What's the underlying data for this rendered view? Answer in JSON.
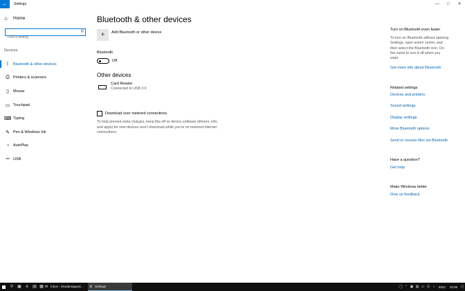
{
  "window": {
    "back_icon": "arrow-left-icon",
    "title": "Settings",
    "controls": [
      "—",
      "□",
      "✕"
    ]
  },
  "sidebar": {
    "home_label": "Home",
    "search_placeholder": "Find a setting",
    "group_label": "Devices",
    "items": [
      {
        "label": "Bluetooth & other devices",
        "icon": "bluetooth-icon",
        "glyph": "ᛒ",
        "active": true
      },
      {
        "label": "Printers & scanners",
        "icon": "printer-icon",
        "glyph": "⎙",
        "active": false
      },
      {
        "label": "Mouse",
        "icon": "mouse-icon",
        "glyph": "▯",
        "active": false
      },
      {
        "label": "Touchpad",
        "icon": "touchpad-icon",
        "glyph": "▭",
        "active": false
      },
      {
        "label": "Typing",
        "icon": "keyboard-icon",
        "glyph": "⌨",
        "active": false
      },
      {
        "label": "Pen & Windows Ink",
        "icon": "pen-icon",
        "glyph": "✎",
        "active": false
      },
      {
        "label": "AutoPlay",
        "icon": "autoplay-icon",
        "glyph": "◔",
        "active": false
      },
      {
        "label": "USB",
        "icon": "usb-icon",
        "glyph": "⎓",
        "active": false
      }
    ]
  },
  "main": {
    "title": "Bluetooth & other devices",
    "add_label": "Add Bluetooth or other device",
    "bluetooth_label": "Bluetooth",
    "bluetooth_state": "Off",
    "other_devices_title": "Other devices",
    "device_name": "Card Reader",
    "device_status": "Connected to USB 3.0",
    "metered_label": "Download over metered connections",
    "metered_desc": "To help prevent extra charges, keep this off so device software (drivers, info, and apps) for new devices won't download while you're on metered Internet connections."
  },
  "right": {
    "faster_title": "Turn on Bluetooth even faster",
    "faster_text": "To turn on Bluetooth without opening Settings, open action center, and then select the Bluetooth icon. Do the same to turn it off when you want.",
    "faster_link": "Get more info about Bluetooth",
    "related_title": "Related settings",
    "related_links": [
      "Devices and printers",
      "Sound settings",
      "Display settings",
      "More Bluetooth options",
      "Send or receive files via Bluetooth"
    ],
    "question_title": "Have a question?",
    "help_link": "Get help",
    "better_title": "Make Windows better",
    "feedback_link": "Give us feedback"
  },
  "taskbar": {
    "apps": [
      {
        "label": "Inbox - ekodamapped...",
        "icon": "mail-app-icon",
        "active": false
      },
      {
        "label": "Settings",
        "icon": "settings-gear-icon",
        "active": true
      }
    ],
    "language": "ENG",
    "time": "16:09"
  },
  "colors": {
    "accent": "#0078d7",
    "link": "#0063b1",
    "taskbar": "#101010"
  }
}
